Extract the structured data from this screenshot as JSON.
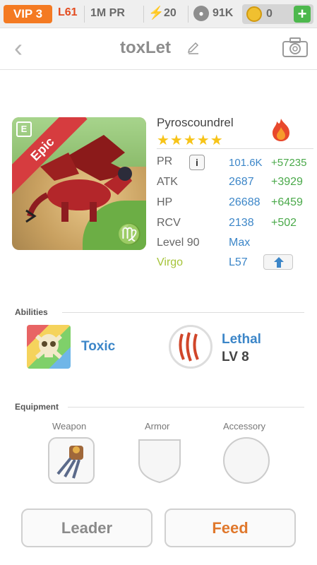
{
  "topbar": {
    "vip": "VIP 3",
    "level": "L61",
    "power": "1M PR",
    "energy": "20",
    "paw": "91K",
    "coins": "0",
    "plus": "+"
  },
  "header": {
    "back": "‹",
    "title": "toxLet"
  },
  "monster": {
    "name": "Pyroscoundrel",
    "stars": "★★★★★",
    "rarity": "Epic",
    "card_badge": "E",
    "zodiac_glyph": "♍",
    "element_icon": "fire-icon",
    "stats": [
      {
        "label": "PR",
        "value": "101.6K",
        "bonus": "+57235"
      },
      {
        "label": "ATK",
        "value": "2687",
        "bonus": "+3929"
      },
      {
        "label": "HP",
        "value": "26688",
        "bonus": "+6459"
      },
      {
        "label": "RCV",
        "value": "2138",
        "bonus": "+502"
      },
      {
        "label": "Level 90",
        "value": "Max"
      },
      {
        "label": "Virgo",
        "value": "L57"
      }
    ],
    "info": "i"
  },
  "abilities": {
    "title": "Abilities",
    "items": [
      {
        "name": "Toxic"
      },
      {
        "name": "Lethal",
        "level": "LV 8"
      }
    ]
  },
  "equipment": {
    "title": "Equipment",
    "slots": [
      {
        "label": "Weapon"
      },
      {
        "label": "Armor"
      },
      {
        "label": "Accessory"
      }
    ]
  },
  "buttons": {
    "leader": "Leader",
    "feed": "Feed"
  },
  "colors": {
    "accent_blue": "#3c86c8",
    "bonus_green": "#4aa94a",
    "vip_orange": "#f47a22",
    "feed_orange": "#e0782c",
    "virgo_green": "#a6c43a"
  }
}
